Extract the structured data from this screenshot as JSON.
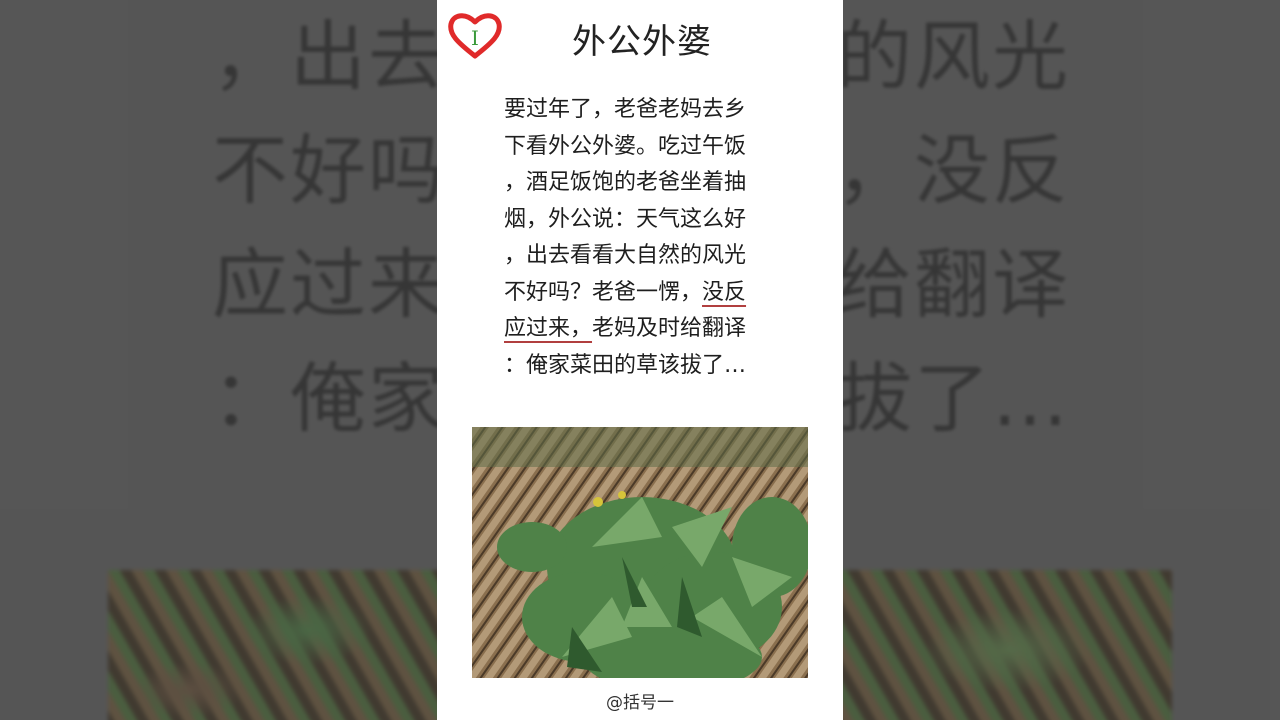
{
  "card": {
    "title": "外公外婆",
    "credit": "@括号一"
  },
  "story": {
    "lines": [
      "要过年了，老爸老妈去乡",
      "下看外公外婆。吃过午饭",
      "，酒足饭饱的老爸坐着抽",
      "烟，外公说：天气这么好",
      "，出去看看大自然的风光",
      "不好吗？老爸一愣，",
      "应过来，",
      "：俺家菜田的草该拔了…"
    ],
    "line6_underlined": "没反",
    "line7_rest": "老妈及时给翻译",
    "highlight_color": "#b13f3f"
  },
  "background": {
    "lines": [
      "，出去看看大自然的风光",
      "不好吗？老爸一愣，没反",
      "应过来，老妈及时给翻译",
      "：俺家菜田的草该拔了…"
    ]
  },
  "icons": {
    "logo": "heart-logo-icon"
  },
  "colors": {
    "logo_red": "#e02a2a",
    "logo_green": "#3a9a3a"
  }
}
